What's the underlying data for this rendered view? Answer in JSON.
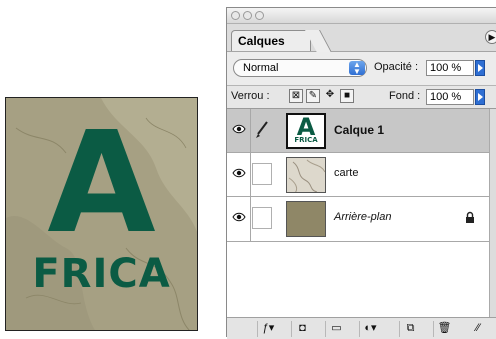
{
  "canvas": {
    "title_big": "A",
    "title_small": "FRICA",
    "text_color": "#0b5b44",
    "background_color": "#a49e80"
  },
  "palette": {
    "tab_label": "Calques",
    "blend_mode": "Normal",
    "opacity_label": "Opacité :",
    "opacity_value": "100 %",
    "lock_label": "Verrou :",
    "fill_label": "Fond :",
    "fill_value": "100 %",
    "layers": [
      {
        "name": "Calque 1",
        "selected": true,
        "bold": true,
        "thumb_text_big": "A",
        "thumb_text_small": "FRICA"
      },
      {
        "name": "carte",
        "selected": false
      },
      {
        "name": "Arrière-plan",
        "selected": false,
        "italic": true,
        "locked": true
      }
    ]
  },
  "icons": {
    "visibility": "eye-icon",
    "brush": "brush-icon",
    "lock": "lock-icon"
  }
}
